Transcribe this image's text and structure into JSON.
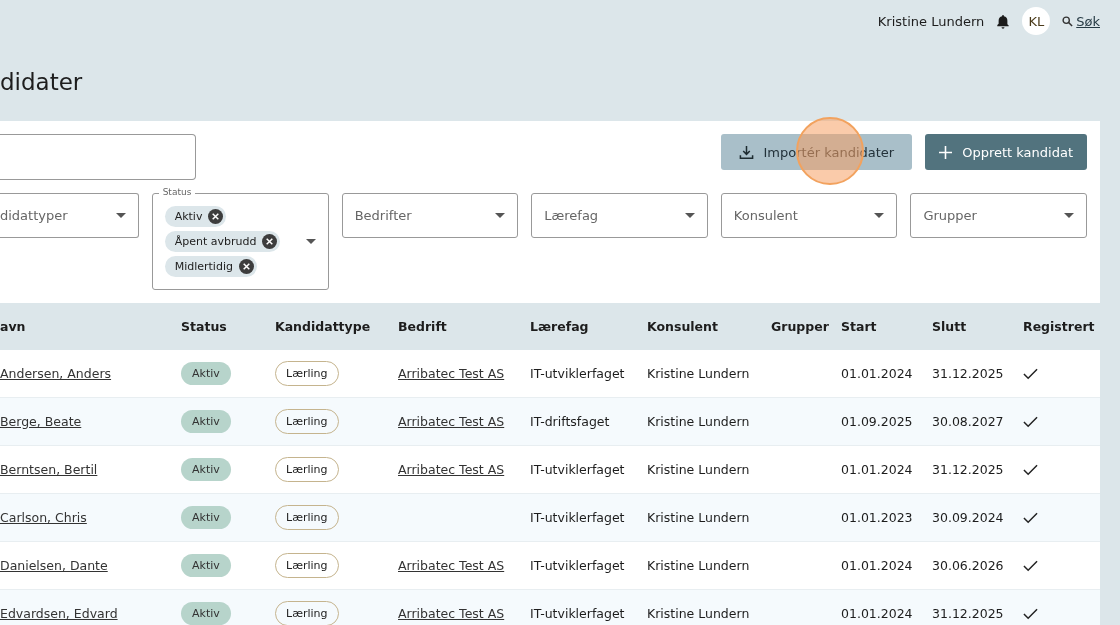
{
  "header": {
    "user_name": "Kristine Lundern",
    "avatar_initials": "KL",
    "search_link": "Søk"
  },
  "page_title": "didater",
  "actions": [
    {
      "kind": "import",
      "label": "Importér kandidater"
    },
    {
      "kind": "create",
      "label": "Opprett kandidat"
    }
  ],
  "filters": [
    {
      "kind": "select",
      "placeholder": "didattyper"
    },
    {
      "kind": "chips",
      "label": "Status",
      "chips": [
        "Aktiv",
        "Åpent avbrudd",
        "Midlertidig"
      ]
    },
    {
      "kind": "select",
      "placeholder": "Bedrifter"
    },
    {
      "kind": "select",
      "placeholder": "Lærefag"
    },
    {
      "kind": "select",
      "placeholder": "Konsulent"
    },
    {
      "kind": "select",
      "placeholder": "Grupper"
    }
  ],
  "table": {
    "columns": [
      "avn",
      "Status",
      "Kandidattype",
      "Bedrift",
      "Lærefag",
      "Konsulent",
      "Grupper",
      "Start",
      "Slutt",
      "Registrert"
    ],
    "rows": [
      {
        "name": "Andersen, Anders",
        "status": "Aktiv",
        "type": "Lærling",
        "company": "Arribatec Test AS",
        "subject": "IT-utviklerfaget",
        "consultant": "Kristine Lundern",
        "start": "01.01.2024",
        "end": "31.12.2025",
        "registered": true
      },
      {
        "name": "Berge, Beate",
        "status": "Aktiv",
        "type": "Lærling",
        "company": "Arribatec Test AS",
        "subject": "IT-driftsfaget",
        "consultant": "Kristine Lundern",
        "start": "01.09.2025",
        "end": "30.08.2027",
        "registered": true
      },
      {
        "name": "Berntsen, Bertil",
        "status": "Aktiv",
        "type": "Lærling",
        "company": "Arribatec Test AS",
        "subject": "IT-utviklerfaget",
        "consultant": "Kristine Lundern",
        "start": "01.01.2024",
        "end": "31.12.2025",
        "registered": true
      },
      {
        "name": "Carlson, Chris",
        "status": "Aktiv",
        "type": "Lærling",
        "subject": "IT-utviklerfaget",
        "consultant": "Kristine Lundern",
        "start": "01.01.2023",
        "end": "30.09.2024",
        "registered": true
      },
      {
        "name": "Danielsen, Dante",
        "status": "Aktiv",
        "type": "Lærling",
        "company": "Arribatec Test AS",
        "subject": "IT-utviklerfaget",
        "consultant": "Kristine Lundern",
        "start": "01.01.2024",
        "end": "30.06.2026",
        "registered": true
      },
      {
        "name": "Edvardsen, Edvard",
        "status": "Aktiv",
        "type": "Lærling",
        "company": "Arribatec Test AS",
        "subject": "IT-utviklerfaget",
        "consultant": "Kristine Lundern",
        "start": "01.01.2024",
        "end": "31.12.2025",
        "registered": true
      }
    ]
  }
}
